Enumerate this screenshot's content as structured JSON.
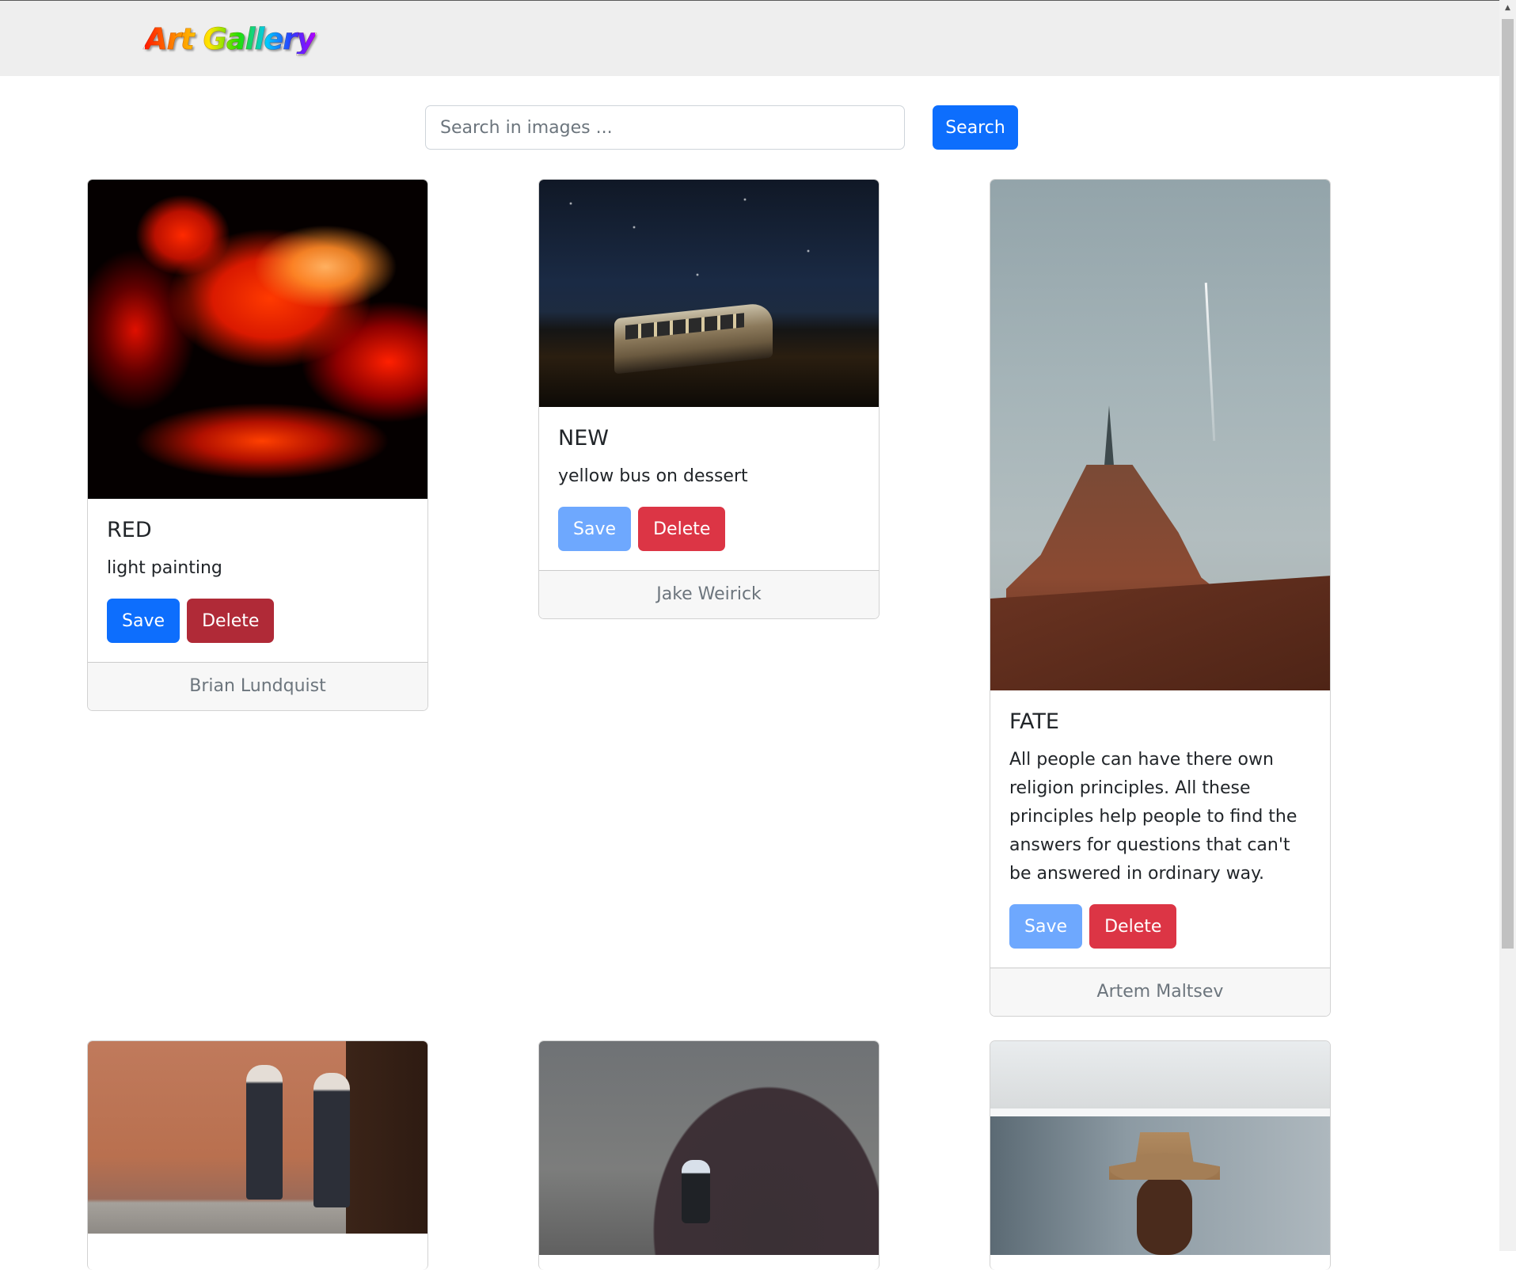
{
  "header": {
    "logo_text": "Art Gallery"
  },
  "search": {
    "placeholder": "Search in images ...",
    "value": "",
    "button_label": "Search"
  },
  "cards": [
    {
      "title": "RED",
      "description": "light painting",
      "save_label": "Save",
      "delete_label": "Delete",
      "author": "Brian Lundquist"
    },
    {
      "title": "NEW",
      "description": "yellow bus on dessert",
      "save_label": "Save",
      "delete_label": "Delete",
      "author": "Jake Weirick"
    },
    {
      "title": "FATE",
      "description": "All people can have there own religion principles. All these principles help people to find the answers for questions that can't be answered in ordinary way.",
      "save_label": "Save",
      "delete_label": "Delete",
      "author": "Artem Maltsev"
    }
  ],
  "colors": {
    "primary": "#0d6efd",
    "primary_faded": "#6ea8fe",
    "danger": "#dc3545",
    "danger_dark": "#b02a37",
    "navbar_bg": "#eeeeee",
    "footer_text": "#6c757d"
  },
  "icons": {
    "scroll_up": "triangle-up-icon"
  }
}
